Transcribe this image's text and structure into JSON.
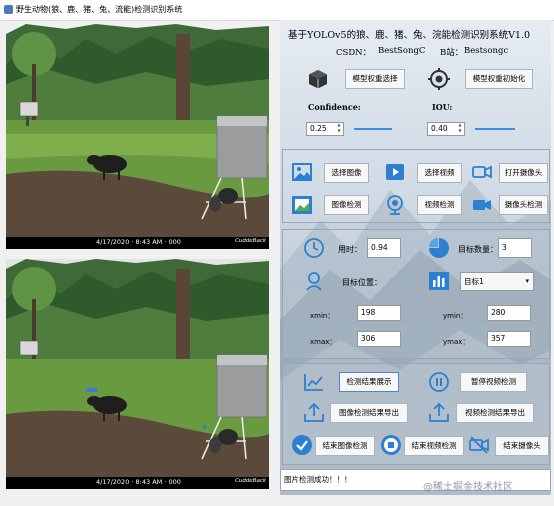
{
  "window": {
    "title": "野生动物(狼、鹿、猪、兔、流能)检测识别系统"
  },
  "images": {
    "top": {
      "timestamp": "4/17/2020 · 8:43 AM · 000",
      "brand": "CuddeBack"
    },
    "bottom": {
      "timestamp": "4/17/2020 · 8:43 AM · 000",
      "brand": "CuddeBack"
    }
  },
  "header": {
    "title": "基于YOLOv5的狼、鹿、猪、兔、浣能检测识别系统V1.0",
    "csdn_label": "CSDN：",
    "csdn_value": "BestSongC",
    "bili_label": "B站：",
    "bili_value": "Bestsongc"
  },
  "model": {
    "select_label": "模型权重选择",
    "init_label": "模型权重初始化"
  },
  "sliders": {
    "confidence_label": "Confidence:",
    "confidence_value": "0.25",
    "iou_label": "IOU:",
    "iou_value": "0.40"
  },
  "buttons": {
    "select_image": "选择图像",
    "select_video": "选择视频",
    "open_camera": "打开摄像头",
    "image_detect": "图像检测",
    "video_detect": "视频检测",
    "camera_detect": "摄像头检测",
    "show_results": "检测结果展示",
    "pause_video": "暂停视频检测",
    "export_image": "图像检测结果导出",
    "export_video": "视频检测结果导出",
    "end_image": "结束图像检测",
    "end_video": "结束视频检测",
    "end_camera": "结束摄像头"
  },
  "results": {
    "time_label": "用时：",
    "time_value": "0.94",
    "count_label": "目标数量：",
    "count_value": "3",
    "position_label": "目标位置：",
    "target_select": "目标1",
    "xmin_label": "xmin：",
    "xmin_value": "198",
    "ymin_label": "ymin：",
    "ymin_value": "280",
    "xmax_label": "xmax：",
    "xmax_value": "306",
    "ymax_label": "ymax：",
    "ymax_value": "357"
  },
  "status": {
    "message": "图片检测成功！！！"
  },
  "watermark": "@稀土掘金技术社区",
  "colors": {
    "accent": "#2d7fd1",
    "slider": "#3c8dde",
    "detect_box": "#3a7bd5"
  },
  "icons": [
    "cube-icon",
    "target-icon",
    "image-icon",
    "video-icon",
    "camera-icon",
    "picture-frame-icon",
    "webcam-icon",
    "video-camera-icon",
    "clock-icon",
    "pie-chart-icon",
    "location-icon",
    "bar-chart-icon",
    "line-chart-icon",
    "pause-icon",
    "upload-icon",
    "check-icon",
    "stop-icon",
    "camera-off-icon"
  ]
}
